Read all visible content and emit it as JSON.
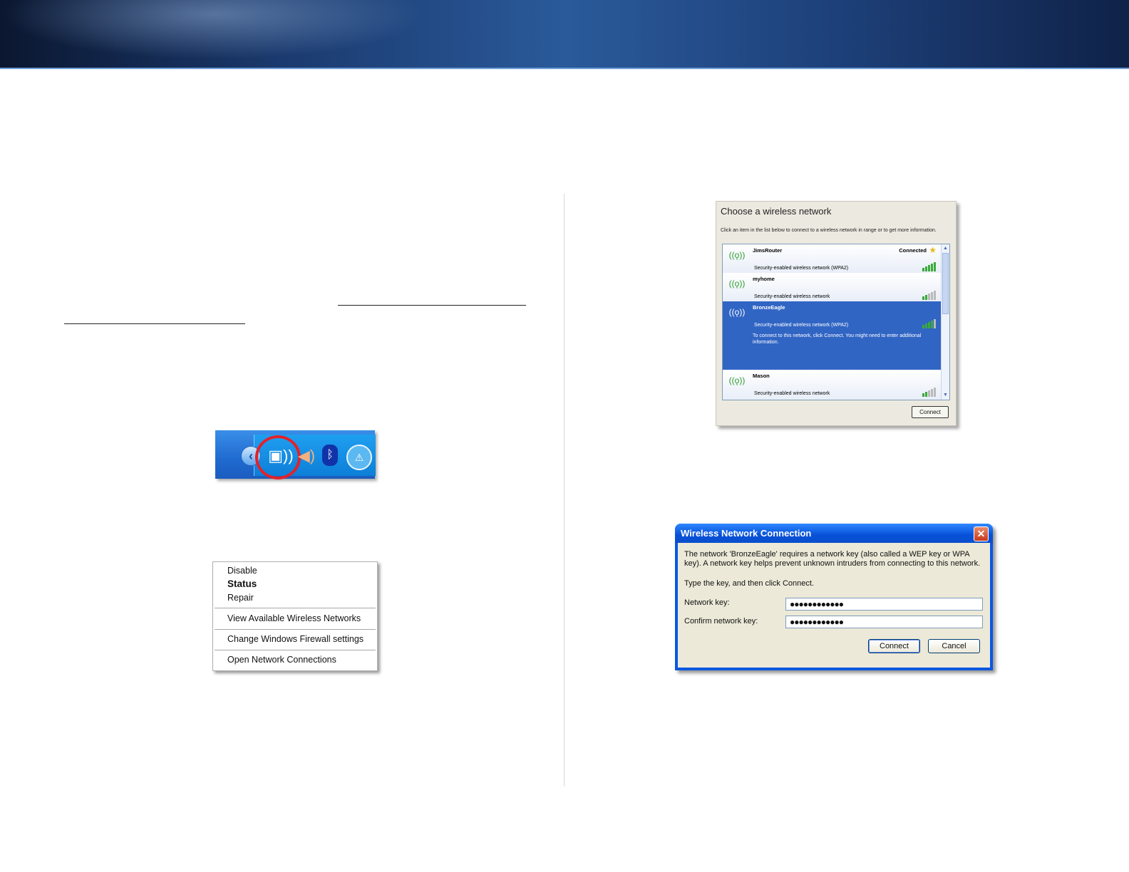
{
  "taskbar": {
    "chevron_icon": "chevron-left-icon",
    "network_icon": "wireless-network-icon",
    "speaker_icon": "speaker-icon",
    "bluetooth_icon": "bluetooth-icon",
    "security_icon": "security-alert-icon",
    "highlight_color": "#e2212a"
  },
  "context_menu": {
    "items": [
      {
        "label": "Disable"
      },
      {
        "label": "Status"
      },
      {
        "label": "Repair"
      },
      {
        "label": "View Available Wireless Networks"
      },
      {
        "label": "Change Windows Firewall settings"
      },
      {
        "label": "Open Network Connections"
      }
    ]
  },
  "choose_network": {
    "title": "Choose a wireless network",
    "description": "Click an item in the list below to connect to a wireless network in range or to get more information.",
    "networks": [
      {
        "name": "JimsRouter",
        "security": "Security-enabled wireless network (WPA2)",
        "status": "Connected",
        "signal": 5
      },
      {
        "name": "myhome",
        "security": "Security-enabled wireless network",
        "signal": 2
      },
      {
        "name": "BronzeEagle",
        "security": "Security-enabled wireless network (WPA2)",
        "info": "To connect to this network, click Connect. You might need to enter additional information.",
        "signal": 4,
        "selected": true
      },
      {
        "name": "Mason",
        "security": "Security-enabled wireless network",
        "signal": 2
      }
    ],
    "connect_button": "Connect",
    "selection_color": "#3165c4"
  },
  "wireless_dialog": {
    "title": "Wireless Network Connection",
    "message": "The network 'BronzeEagle' requires a network key (also called a WEP key or WPA key). A network key helps prevent unknown intruders from connecting to this network.",
    "instruction": "Type the key, and then click Connect.",
    "network_key_label": "Network key:",
    "network_key_value": "●●●●●●●●●●●●",
    "confirm_key_label": "Confirm network key:",
    "confirm_key_value": "●●●●●●●●●●●●",
    "connect_button": "Connect",
    "cancel_button": "Cancel",
    "titlebar_color": "#0750d8"
  }
}
